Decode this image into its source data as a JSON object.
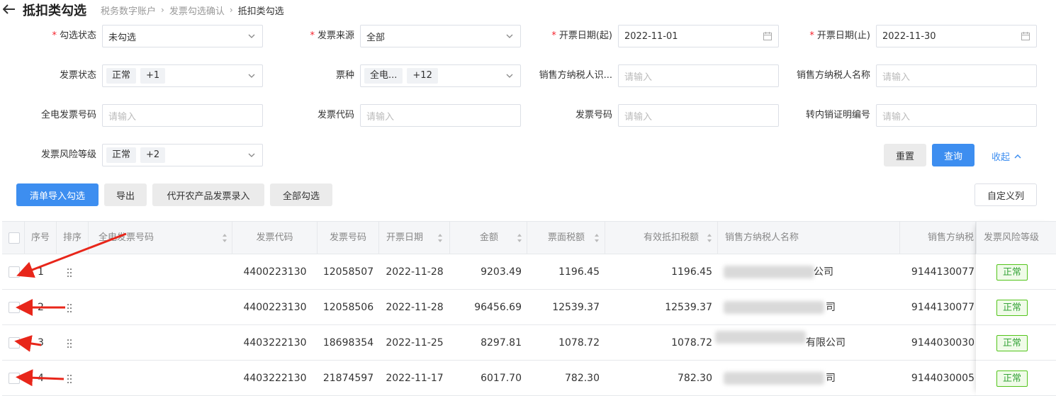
{
  "header": {
    "back_icon": "arrow-left-icon",
    "title": "抵扣类勾选",
    "breadcrumb": [
      "税务数字账户",
      "发票勾选确认",
      "抵扣类勾选"
    ]
  },
  "form": {
    "row1": [
      {
        "label": "勾选状态",
        "value": "未勾选",
        "required": true,
        "type": "select"
      },
      {
        "label": "发票来源",
        "value": "全部",
        "required": true,
        "type": "select"
      },
      {
        "label": "开票日期(起)",
        "value": "2022-11-01",
        "required": true,
        "type": "date"
      },
      {
        "label": "开票日期(止)",
        "value": "2022-11-30",
        "required": true,
        "type": "date"
      }
    ],
    "row2": [
      {
        "label": "发票状态",
        "tags": [
          "正常",
          "+1"
        ],
        "type": "select"
      },
      {
        "label": "票种",
        "tags": [
          "全电...",
          "+12"
        ],
        "type": "select"
      },
      {
        "label": "销售方纳税人识...",
        "placeholder": "请输入"
      },
      {
        "label": "销售方纳税人名称",
        "placeholder": "请输入"
      }
    ],
    "row3": [
      {
        "label": "全电发票号码",
        "placeholder": "请输入"
      },
      {
        "label": "发票代码",
        "placeholder": "请输入"
      },
      {
        "label": "发票号码",
        "placeholder": "请输入"
      },
      {
        "label": "转内销证明编号",
        "placeholder": "请输入"
      }
    ],
    "row4": {
      "label": "发票风险等级",
      "tags": [
        "正常",
        "+2"
      ]
    },
    "reset_label": "重置",
    "query_label": "查询",
    "collapse_label": "收起"
  },
  "toolbar": {
    "import_label": "清单导入勾选",
    "export_label": "导出",
    "agri_label": "代开农产品发票录入",
    "select_all_label": "全部勾选",
    "custom_cols_label": "自定义列"
  },
  "table": {
    "headers": {
      "index": "序号",
      "sort": "排序",
      "full_invoice_no": "全电发票号码",
      "invoice_code": "发票代码",
      "invoice_no": "发票号码",
      "issue_date": "开票日期",
      "amount": "金额",
      "tax": "票面税额",
      "valid_tax": "有效抵扣税额",
      "seller_name": "销售方纳税人名称",
      "seller_id": "销售方纳税",
      "risk": "发票风险等级"
    },
    "rows": [
      {
        "index": "1",
        "invoice_code": "4400223130",
        "invoice_no": "12058507",
        "issue_date": "2022-11-28",
        "amount": "9203.49",
        "tax": "1196.45",
        "valid_tax": "1196.45",
        "seller_name": "公司",
        "seller_id": "9144130077",
        "risk": "正常"
      },
      {
        "index": "2",
        "invoice_code": "4400223130",
        "invoice_no": "12058506",
        "issue_date": "2022-11-28",
        "amount": "96456.69",
        "tax": "12539.37",
        "valid_tax": "12539.37",
        "seller_name": "司",
        "seller_id": "9144130077",
        "risk": "正常"
      },
      {
        "index": "3",
        "invoice_code": "4403222130",
        "invoice_no": "18698354",
        "issue_date": "2022-11-25",
        "amount": "8297.81",
        "tax": "1078.72",
        "valid_tax": "1078.72",
        "seller_name": "有限公司",
        "seller_id": "9144030030",
        "risk": "正常"
      },
      {
        "index": "4",
        "invoice_code": "4403222130",
        "invoice_no": "21874597",
        "issue_date": "2022-11-17",
        "amount": "6017.70",
        "tax": "782.30",
        "valid_tax": "782.30",
        "seller_name": "司",
        "seller_id": "9144030005",
        "risk": "正常"
      }
    ]
  },
  "colors": {
    "primary": "#3d8ef0",
    "required": "#f5222d",
    "success": "#52c41a",
    "annotation_arrow": "#e8261a"
  }
}
